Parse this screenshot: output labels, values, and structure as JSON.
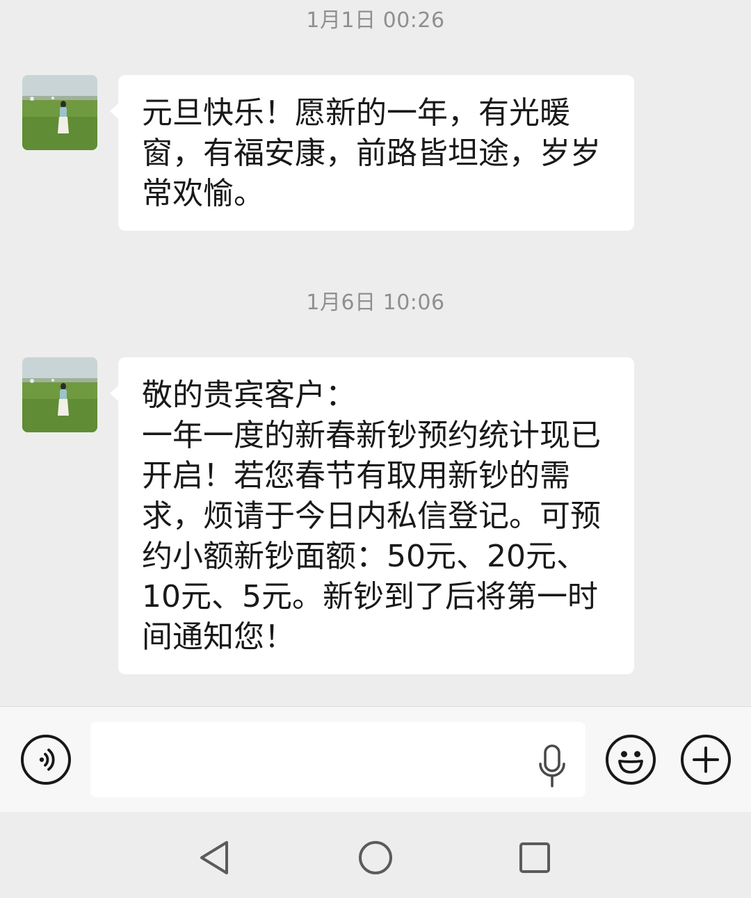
{
  "messages": [
    {
      "timestamp": "1月1日 00:26",
      "lines": [
        "元旦快乐！愿新的一年，有光暖",
        "窗，有福安康，前路皆坦途，岁岁",
        "常欢愉。"
      ]
    },
    {
      "timestamp": "1月6日 10:06",
      "lines": [
        "敬的贵宾客户：",
        "一年一度的新春新钞预约统计现已",
        "开启！若您春节有取用新钞的需",
        "求，烦请于今日内私信登记。可预",
        "约小额新钞面额：50元、20元、",
        "10元、5元。新钞到了后将第一时",
        "间通知您！"
      ]
    }
  ],
  "input_bar": {
    "icons": [
      "voice-toggle-icon",
      "microphone-icon",
      "emoji-icon",
      "plus-icon"
    ],
    "text_value": ""
  },
  "nav": {
    "icons": [
      "back-triangle-icon",
      "home-circle-icon",
      "recents-square-icon"
    ]
  },
  "colors": {
    "background": "#ededed",
    "bubble": "#ffffff",
    "timestamp": "#8f8f8f",
    "text": "#191919"
  }
}
